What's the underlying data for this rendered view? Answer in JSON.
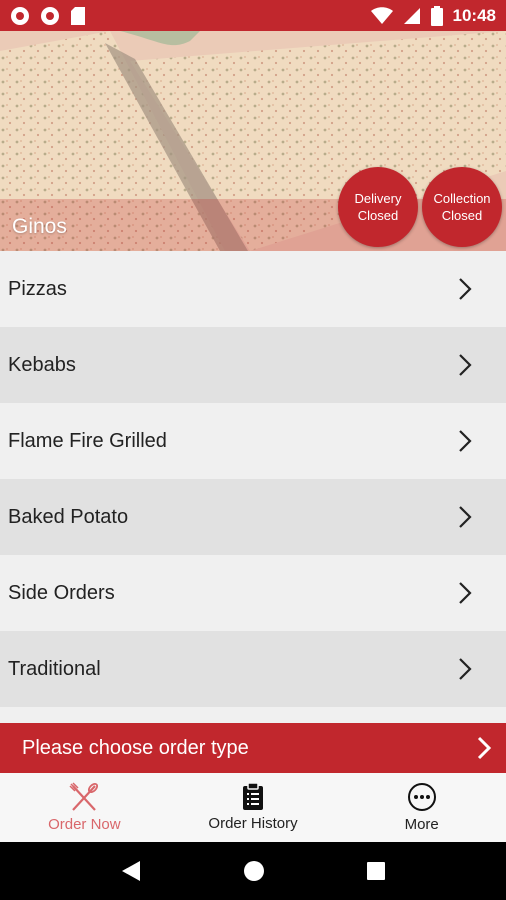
{
  "status_bar": {
    "time": "10:48",
    "icons": [
      "notification-icon",
      "notification-icon",
      "sd-card-icon",
      "wifi-icon",
      "signal-icon",
      "battery-icon"
    ]
  },
  "hero": {
    "restaurant_name": "Ginos",
    "badges": {
      "delivery": {
        "line1": "Delivery",
        "line2": "Closed"
      },
      "collection": {
        "line1": "Collection",
        "line2": "Closed"
      }
    }
  },
  "menu": {
    "items": [
      {
        "label": "Pizzas"
      },
      {
        "label": "Kebabs"
      },
      {
        "label": "Flame Fire Grilled"
      },
      {
        "label": "Baked Potato"
      },
      {
        "label": "Side Orders"
      },
      {
        "label": "Traditional"
      }
    ]
  },
  "order_type": {
    "label": "Please choose order type"
  },
  "bottom_nav": {
    "order_now": "Order Now",
    "order_history": "Order History",
    "more": "More"
  },
  "colors": {
    "accent": "#c1272d",
    "active_nav": "#d9676b"
  }
}
